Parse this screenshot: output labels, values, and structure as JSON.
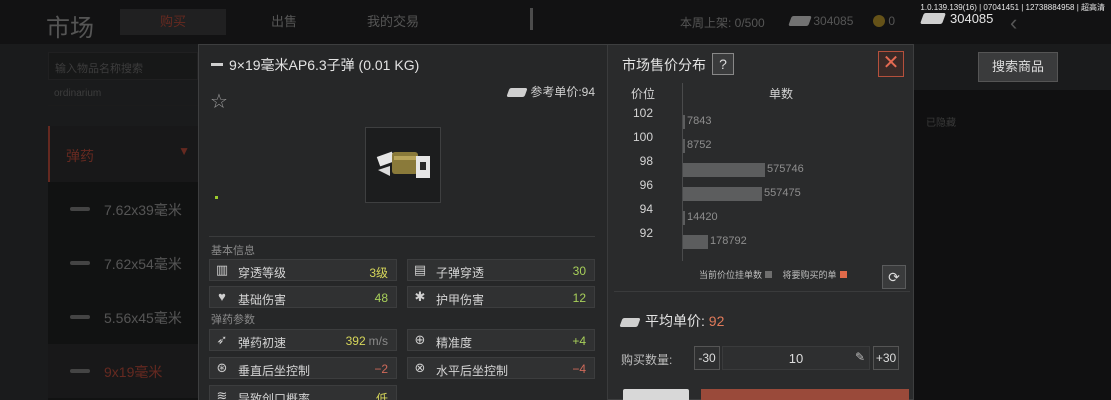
{
  "build_info": "1.0.139.139(16) | 07041451 | 12738884958 | 超高清",
  "header": {
    "title": "市场",
    "tabs": [
      {
        "label": "购买",
        "active": true
      },
      {
        "label": "出售",
        "active": false
      },
      {
        "label": "我的交易",
        "active": false
      }
    ],
    "listing_label": "本周上架: 0/500",
    "cash_dim": "304085",
    "coins": "0",
    "cash_bright": "304085"
  },
  "left": {
    "search_placeholder": "输入物品名称搜索",
    "sort_label": "ordinarium",
    "category": "弹药",
    "items": [
      {
        "label": "7.62x39毫米",
        "active": false
      },
      {
        "label": "7.62x54毫米",
        "active": false
      },
      {
        "label": "5.56x45毫米",
        "active": false
      },
      {
        "label": "9x19毫米",
        "active": true
      }
    ]
  },
  "search_button": "搜索商品",
  "right_faint": "已隐藏",
  "item": {
    "name": "9×19毫米AP6.3子弹 (0.01 KG)",
    "ref_price_label": "参考单价:94",
    "basic_info_label": "基本信息",
    "ammo_params_label": "弹药参数",
    "stats": [
      {
        "icon": "penetration-icon",
        "label": "穿透等级",
        "value": "3级",
        "color": "yellow"
      },
      {
        "icon": "bullet-penetration-icon",
        "label": "子弹穿透",
        "value": "30",
        "color": "green"
      },
      {
        "icon": "broken-heart-icon",
        "label": "基础伤害",
        "value": "48",
        "color": "green"
      },
      {
        "icon": "armor-damage-icon",
        "label": "护甲伤害",
        "value": "12",
        "color": "green"
      },
      {
        "icon": "velocity-icon",
        "label": "弹药初速",
        "value": "392",
        "unit": "m/s",
        "color": "yellow"
      },
      {
        "icon": "crosshair-icon",
        "label": "精准度",
        "value": "+4",
        "color": "green"
      },
      {
        "icon": "vertical-recoil-icon",
        "label": "垂直后坐控制",
        "value": "−2",
        "color": "red"
      },
      {
        "icon": "horizontal-recoil-icon",
        "label": "水平后坐控制",
        "value": "−4",
        "color": "red"
      },
      {
        "icon": "bleed-icon",
        "label": "导致创口概率",
        "value": "低",
        "color": "yellow"
      }
    ]
  },
  "distribution": {
    "title": "市场售价分布",
    "help": "?",
    "close": "✕",
    "price_header": "价位",
    "count_header": "单数",
    "legend_current": "当前价位挂单数",
    "legend_buy": "将要购买的单",
    "colors": {
      "current": "#6e6e6e",
      "buy": "#e06a4a"
    }
  },
  "chart_data": {
    "type": "bar",
    "orientation": "horizontal",
    "categories": [
      "102",
      "100",
      "98",
      "96",
      "94",
      "92"
    ],
    "values": [
      7843,
      8752,
      575746,
      557475,
      14420,
      178792
    ],
    "xlabel": "单数",
    "ylabel": "价位"
  },
  "purchase": {
    "avg_label": "平均单价:",
    "avg_value": "92",
    "qty_label": "购买数量:",
    "minus": "-30",
    "qty": "10",
    "plus": "+30"
  }
}
